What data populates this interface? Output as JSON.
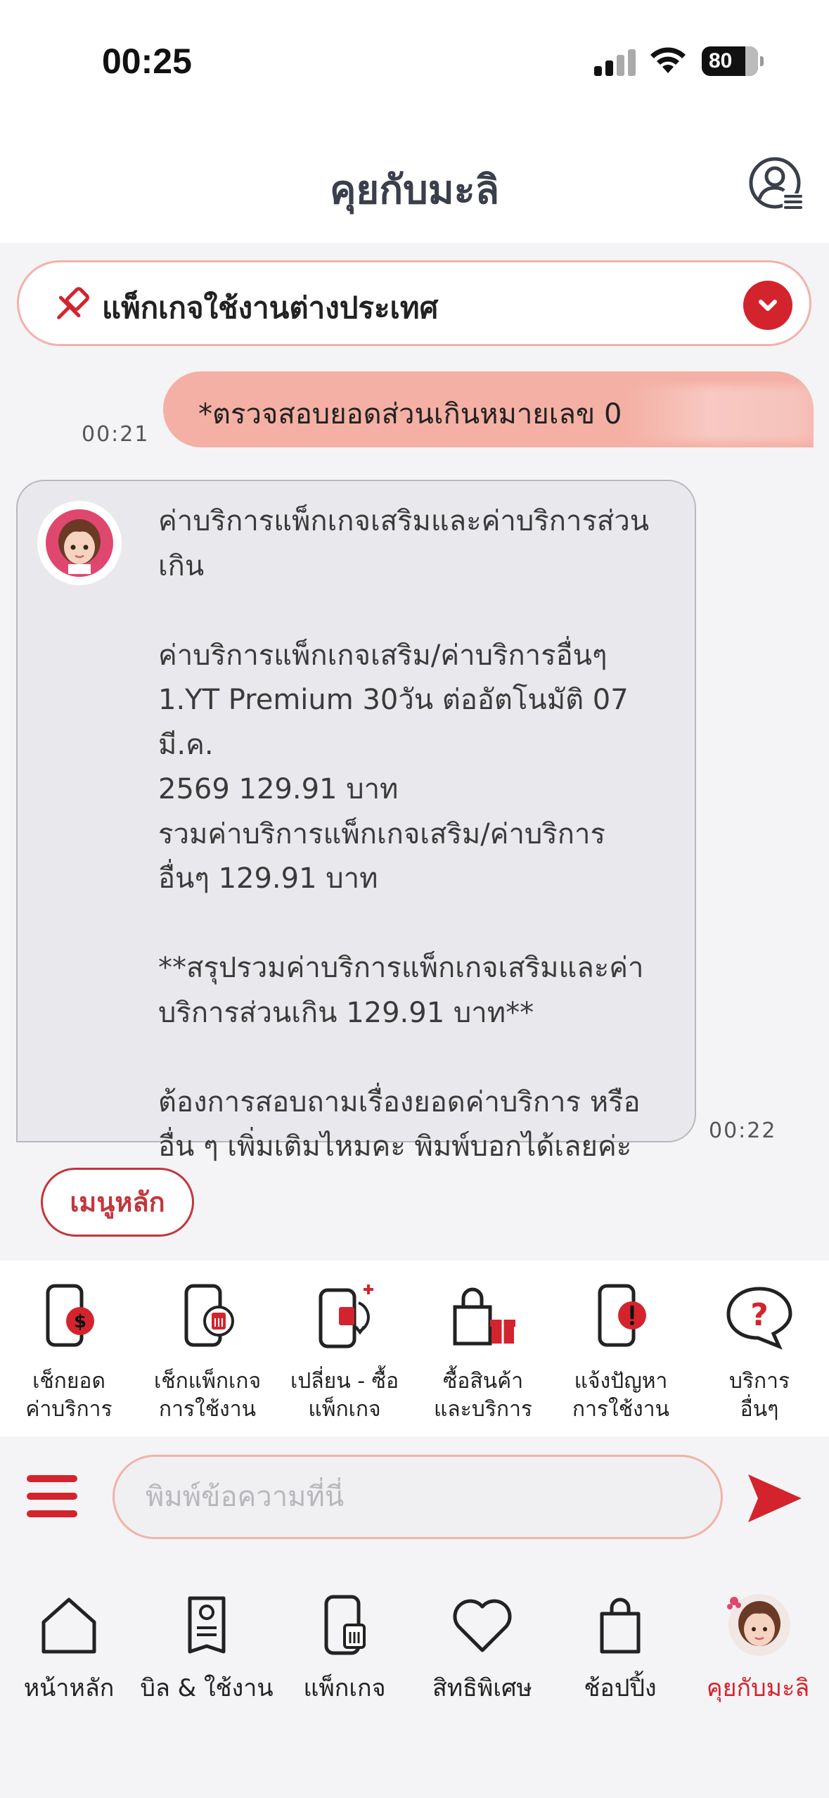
{
  "status_bar": {
    "time": "00:25",
    "battery": "80"
  },
  "header": {
    "title": "คุยกับมะลิ",
    "profile_icon": "user-settings-icon"
  },
  "pinned": {
    "text": "แพ็กเกจใช้งานต่างประเทศ",
    "icon": "pin-icon"
  },
  "chat": {
    "user_message": {
      "text": "*ตรวจสอบยอดส่วนเกินหมายเลข 0",
      "time": "00:21"
    },
    "bot_message": {
      "paragraphs": [
        "ค่าบริการแพ็กเกจเสริมและค่าบริการส่วน\nเกิน",
        "ค่าบริการแพ็กเกจเสริม/ค่าบริการอื่นๆ\n1.YT Premium 30วัน ต่ออัตโนมัติ 07 มี.ค.\n2569 129.91 บาท\nรวมค่าบริการแพ็กเกจเสริม/ค่าบริการ\nอื่นๆ 129.91 บาท",
        "**สรุปรวมค่าบริการแพ็กเกจเสริมและค่า\nบริการส่วนเกิน 129.91 บาท**",
        "ต้องการสอบถามเรื่องยอดค่าบริการ หรือ\nอื่น ๆ เพิ่มเติมไหมคะ พิมพ์บอกได้เลยค่ะ"
      ],
      "time": "00:22"
    },
    "menu_button": "เมนูหลัก"
  },
  "quick_actions": [
    {
      "label": "เช็กยอด\nค่าบริการ",
      "icon": "phone-bill-icon"
    },
    {
      "label": "เช็กแพ็กเกจ\nการใช้งาน",
      "icon": "phone-sim-icon"
    },
    {
      "label": "เปลี่ยน - ซื้อ\nแพ็กเกจ",
      "icon": "phone-swap-icon"
    },
    {
      "label": "ซื้อสินค้า\nและบริการ",
      "icon": "shopping-gift-icon"
    },
    {
      "label": "แจ้งปัญหา\nการใช้งาน",
      "icon": "phone-alert-icon"
    },
    {
      "label": "บริการ\nอื่นๆ",
      "icon": "question-bubble-icon"
    }
  ],
  "input": {
    "placeholder": "พิมพ์ข้อความที่นี่",
    "value": ""
  },
  "bottom_nav": [
    {
      "label": "หน้าหลัก",
      "icon": "home-icon",
      "active": false
    },
    {
      "label": "บิล & ใช้งาน",
      "icon": "bill-icon",
      "active": false
    },
    {
      "label": "แพ็กเกจ",
      "icon": "package-icon",
      "active": false
    },
    {
      "label": "สิทธิพิเศษ",
      "icon": "heart-icon",
      "active": false
    },
    {
      "label": "ช้อปปิ้ง",
      "icon": "shopping-bag-icon",
      "active": false
    },
    {
      "label": "คุยกับมะลิ",
      "icon": "mali-avatar-icon",
      "active": true
    }
  ],
  "colors": {
    "accent": "#d3242d",
    "user_bubble": "#f4b0a5",
    "bot_bubble": "#e9e9ed",
    "outline": "#f2b2a8"
  }
}
